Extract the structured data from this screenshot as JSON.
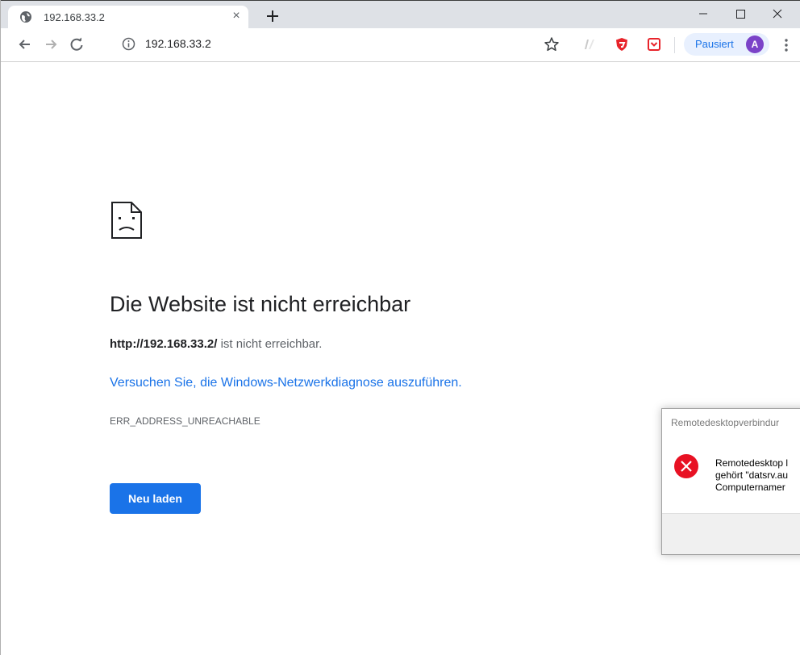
{
  "browser": {
    "tab": {
      "title": "192.168.33.2",
      "favicon": "globe-icon",
      "close_glyph": "×"
    },
    "new_tab_icon": "plus-icon",
    "window_controls": [
      "minimize-icon",
      "maximize-icon",
      "close-icon"
    ],
    "toolbar": {
      "back_icon": "arrow-left-icon",
      "forward_icon": "arrow-right-icon",
      "reload_icon": "reload-icon",
      "site_info_icon": "info-icon",
      "url": "192.168.33.2",
      "bookmark_icon": "star-icon",
      "extensions": [
        "extension-icon",
        "shield-extension-icon",
        "pocket-extension-icon"
      ],
      "profile": {
        "label": "Pausiert",
        "avatar_letter": "A",
        "avatar_color": "#7b43c8"
      },
      "menu_icon": "kebab-menu-icon"
    }
  },
  "error_page": {
    "icon": "sad-page-icon",
    "heading": "Die Website ist nicht erreichbar",
    "url_bold": "http://192.168.33.2/",
    "url_suffix": " ist nicht erreichbar.",
    "diagnose_link": "Versuchen Sie, die Windows-Netzwerkdiagnose auszuführen.",
    "error_code": "ERR_ADDRESS_UNREACHABLE",
    "reload_button": "Neu laden",
    "accent_color": "#1a73e8"
  },
  "dialog": {
    "title": "Remotedesktopverbindur",
    "icon": "error-x-icon",
    "message_lines": [
      "Remotedesktop l",
      "gehört \"datsrv.au",
      "Computernamer"
    ]
  }
}
